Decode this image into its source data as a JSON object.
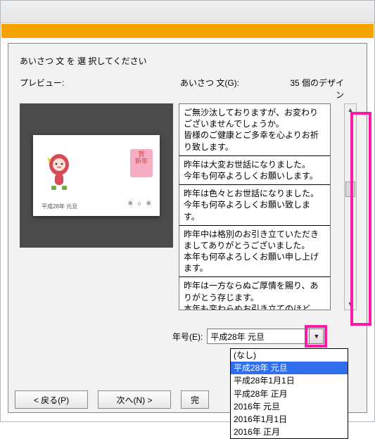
{
  "instruction": "あいさつ 文 を 選 択してください",
  "labels": {
    "preview": "プレビュー:",
    "greeting": "あいさつ 文(G):",
    "count": "35 個のデザイン"
  },
  "preview_card": {
    "stamp_line1": "賀",
    "stamp_line2": "新年",
    "dots": "※ ○ ※",
    "year_text": "平成28年 元旦"
  },
  "greetings": [
    "ご無沙汰しておりますが、お変わりございませんでしょうか。\n皆様のご健康とご多幸を心よりお祈り致します。",
    "昨年は大変お世話になりました。\n今年も何卒よろしくお願いします。",
    "昨年は色々とお世話になりました。\n今年も何卒よろしくお願い致します。",
    "昨年中は格別のお引き立ていただきましてありがとうございました。\n本年も何卒よろしくお願い申し上げます。",
    "昨年は一方ならぬご厚情を賜り、ありがとう存じます。\n本年も変わらぬお引き立てのほど"
  ],
  "era": {
    "label": "年号(E):",
    "selected": "平成28年 元旦",
    "options": [
      "(なし)",
      "平成28年 元旦",
      "平成28年1月1日",
      "平成28年 正月",
      "2016年 元旦",
      "2016年1月1日",
      "2016年 正月"
    ],
    "selected_index": 1
  },
  "buttons": {
    "back": "< 戻る(P)",
    "next": "次へ(N) >",
    "finish": "完"
  }
}
